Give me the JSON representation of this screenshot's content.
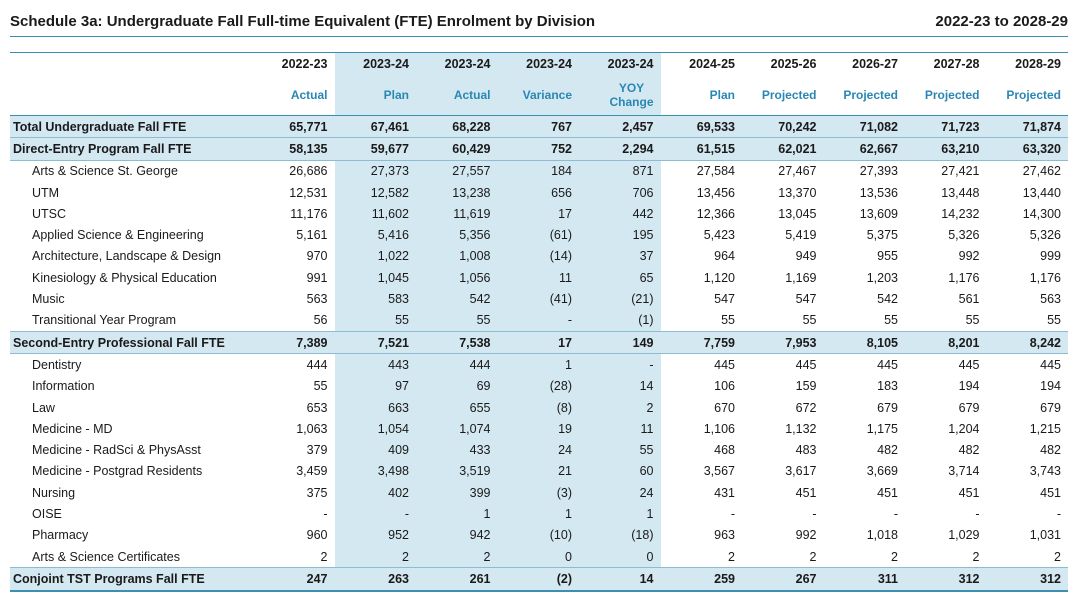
{
  "header": {
    "title": "Schedule 3a:  Undergraduate Fall Full-time Equivalent (FTE) Enrolment by Division",
    "range": "2022-23 to 2028-29"
  },
  "columns": [
    {
      "year": "2022-23",
      "type": "Actual"
    },
    {
      "year": "2023-24",
      "type": "Plan"
    },
    {
      "year": "2023-24",
      "type": "Actual"
    },
    {
      "year": "2023-24",
      "type": "Variance"
    },
    {
      "year": "2023-24",
      "type": "YOY",
      "type2": "Change"
    },
    {
      "year": "2024-25",
      "type": "Plan"
    },
    {
      "year": "2025-26",
      "type": "Projected"
    },
    {
      "year": "2026-27",
      "type": "Projected"
    },
    {
      "year": "2027-28",
      "type": "Projected"
    },
    {
      "year": "2028-29",
      "type": "Projected"
    }
  ],
  "rows": [
    {
      "label": "Total Undergraduate Fall FTE",
      "total": true,
      "values": [
        "65,771",
        "67,461",
        "68,228",
        "767",
        "2,457",
        "69,533",
        "70,242",
        "71,082",
        "71,723",
        "71,874"
      ]
    },
    {
      "label": "Direct-Entry Program Fall FTE",
      "total": true,
      "values": [
        "58,135",
        "59,677",
        "60,429",
        "752",
        "2,294",
        "61,515",
        "62,021",
        "62,667",
        "63,210",
        "63,320"
      ]
    },
    {
      "label": "Arts & Science St. George",
      "values": [
        "26,686",
        "27,373",
        "27,557",
        "184",
        "871",
        "27,584",
        "27,467",
        "27,393",
        "27,421",
        "27,462"
      ]
    },
    {
      "label": "UTM",
      "values": [
        "12,531",
        "12,582",
        "13,238",
        "656",
        "706",
        "13,456",
        "13,370",
        "13,536",
        "13,448",
        "13,440"
      ]
    },
    {
      "label": "UTSC",
      "values": [
        "11,176",
        "11,602",
        "11,619",
        "17",
        "442",
        "12,366",
        "13,045",
        "13,609",
        "14,232",
        "14,300"
      ]
    },
    {
      "label": "Applied Science & Engineering",
      "values": [
        "5,161",
        "5,416",
        "5,356",
        "(61)",
        "195",
        "5,423",
        "5,419",
        "5,375",
        "5,326",
        "5,326"
      ]
    },
    {
      "label": "Architecture, Landscape & Design",
      "values": [
        "970",
        "1,022",
        "1,008",
        "(14)",
        "37",
        "964",
        "949",
        "955",
        "992",
        "999"
      ]
    },
    {
      "label": "Kinesiology & Physical Education",
      "values": [
        "991",
        "1,045",
        "1,056",
        "11",
        "65",
        "1,120",
        "1,169",
        "1,203",
        "1,176",
        "1,176"
      ]
    },
    {
      "label": "Music",
      "values": [
        "563",
        "583",
        "542",
        "(41)",
        "(21)",
        "547",
        "547",
        "542",
        "561",
        "563"
      ]
    },
    {
      "label": "Transitional Year Program",
      "values": [
        "56",
        "55",
        "55",
        "-",
        "(1)",
        "55",
        "55",
        "55",
        "55",
        "55"
      ]
    },
    {
      "label": "Second-Entry Professional Fall FTE",
      "total": true,
      "values": [
        "7,389",
        "7,521",
        "7,538",
        "17",
        "149",
        "7,759",
        "7,953",
        "8,105",
        "8,201",
        "8,242"
      ]
    },
    {
      "label": "Dentistry",
      "values": [
        "444",
        "443",
        "444",
        "1",
        "-",
        "445",
        "445",
        "445",
        "445",
        "445"
      ]
    },
    {
      "label": "Information",
      "values": [
        "55",
        "97",
        "69",
        "(28)",
        "14",
        "106",
        "159",
        "183",
        "194",
        "194"
      ]
    },
    {
      "label": "Law",
      "values": [
        "653",
        "663",
        "655",
        "(8)",
        "2",
        "670",
        "672",
        "679",
        "679",
        "679"
      ]
    },
    {
      "label": "Medicine - MD",
      "values": [
        "1,063",
        "1,054",
        "1,074",
        "19",
        "11",
        "1,106",
        "1,132",
        "1,175",
        "1,204",
        "1,215"
      ]
    },
    {
      "label": "Medicine - RadSci & PhysAsst",
      "values": [
        "379",
        "409",
        "433",
        "24",
        "55",
        "468",
        "483",
        "482",
        "482",
        "482"
      ]
    },
    {
      "label": "Medicine - Postgrad Residents",
      "values": [
        "3,459",
        "3,498",
        "3,519",
        "21",
        "60",
        "3,567",
        "3,617",
        "3,669",
        "3,714",
        "3,743"
      ]
    },
    {
      "label": "Nursing",
      "values": [
        "375",
        "402",
        "399",
        "(3)",
        "24",
        "431",
        "451",
        "451",
        "451",
        "451"
      ]
    },
    {
      "label": "OISE",
      "values": [
        "-",
        "-",
        "1",
        "1",
        "1",
        "-",
        "-",
        "-",
        "-",
        "-"
      ]
    },
    {
      "label": "Pharmacy",
      "values": [
        "960",
        "952",
        "942",
        "(10)",
        "(18)",
        "963",
        "992",
        "1,018",
        "1,029",
        "1,031"
      ]
    },
    {
      "label": "Arts & Science Certificates",
      "values": [
        "2",
        "2",
        "2",
        "0",
        "0",
        "2",
        "2",
        "2",
        "2",
        "2"
      ]
    },
    {
      "label": "Conjoint TST Programs Fall FTE",
      "total": true,
      "values": [
        "247",
        "263",
        "261",
        "(2)",
        "14",
        "259",
        "267",
        "311",
        "312",
        "312"
      ]
    }
  ]
}
